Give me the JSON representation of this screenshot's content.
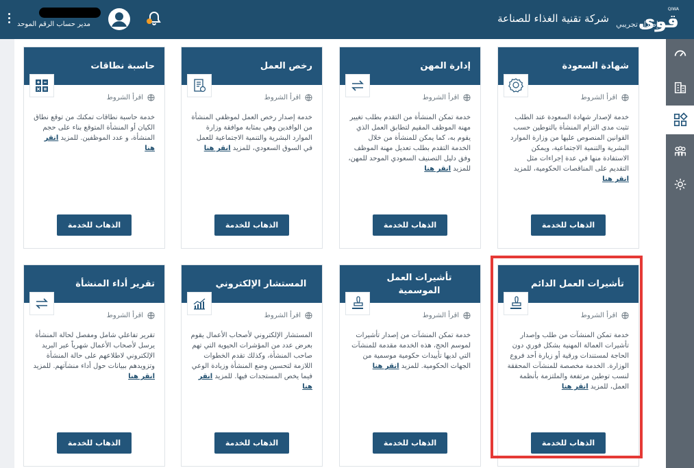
{
  "header": {
    "brand_ar": "قوى",
    "brand_en": "QIWA",
    "beta_label": "إصدار تجريبي",
    "company_name": "شركة تقنية الغذاء للصناعة",
    "user_role": "مدير حساب الرقم الموحد"
  },
  "rail": {
    "items": [
      "dashboard-icon",
      "buildings-icon",
      "services-grid-icon",
      "users-icon",
      "settings-icon"
    ],
    "active_index": 2
  },
  "common": {
    "terms_label": "اقرأ الشروط",
    "go_button": "الذهاب للخدمة",
    "more_link": "انقر هنا"
  },
  "cards": [
    {
      "title": "شهادة السعودة",
      "icon": "certificate-icon",
      "desc": "خدمة لإصدار شهادة السعودة عند الطلب تثبت مدى التزام المنشأة بالتوطين حسب القوانين المنصوص عليها من وزارة الموارد البشرية والتنمية الاجتماعية، ويمكن الاستفادة منها في عدة إجراءات مثل التقديم على المناقصات الحكومية، للمزيد"
    },
    {
      "title": "إدارة المهن",
      "icon": "swap-arrows-icon",
      "desc": "خدمة تمكن المنشأة من التقدم بطلب تغيير مهنة الموظف المقيم لتطابق العمل الذي يقوم به، كما يمكن للمنشأة من خلال الخدمة التقدم بطلب تعديل مهنة الموظف وفق دليل التصنيف السعودي الموحد للمهن، للمزيد"
    },
    {
      "title": "رخص العمل",
      "icon": "license-document-icon",
      "desc": "خدمة إصدار رخص العمل لموظفي المنشأة من الوافدين وهي بمثابة موافقة وزارة الموارد البشرية والتنمية الاجتماعية للعمل في السوق السعودي، للمزيد"
    },
    {
      "title": "حاسبة نطاقات",
      "icon": "calculator-icon",
      "desc": "خدمة حاسبة نطاقات تمكنك من توقع نطاق الكيان أو المنشأة المتوقع بناء على حجم المنشأة، و عدد الموظفين. للمزيد"
    },
    {
      "title": "تأشيرات العمل الدائم",
      "icon": "stamp-icon",
      "desc": "خدمة تمكن المنشآت من طلب وإصدار تأشيرات العمالة المهنية بشكل فوري دون الحاجة لمستندات ورقية أو زيارة أحد فروع الوزارة. الخدمة مخصصة للمنشآت المحققة لنسب توطين مرتفعة والملتزمة بأنظمة العمل، للمزيد"
    },
    {
      "title": "تأشيرات العمل الموسمية",
      "icon": "stamp-icon",
      "desc": "خدمة تمكن المنشآت من إصدار تأشيرات لموسم الحج، هذه الخدمة مقدمة للمنشآت التي لديها تأييدات حكومية موسمية من الجهات الحكومية. للمزيد"
    },
    {
      "title": "المستشار الإلكتروني",
      "icon": "growth-chart-icon",
      "desc": "المستشار الإلكتروني لأصحاب الأعمال يقوم بعرض عدد من المؤشرات الحيوية التي تهم صاحب المنشأة، وكذلك تقدم الخطوات اللازمة لتحسين وضع المنشأة وزيادة الوعي فيما يخص المستجدات فيها. للمزيد"
    },
    {
      "title": "تقرير أداء المنشأة",
      "icon": "swap-arrows-icon",
      "desc": "تقرير تفاعلي شامل ومفصل لحالة المنشأة يرسل لأصحاب الأعمال شهرياً عبر البريد الإلكتروني لاطلاعهم على حالة المنشأة وتزويدهم ببيانات حول أداء منشآتهم. للمزيد"
    }
  ]
}
